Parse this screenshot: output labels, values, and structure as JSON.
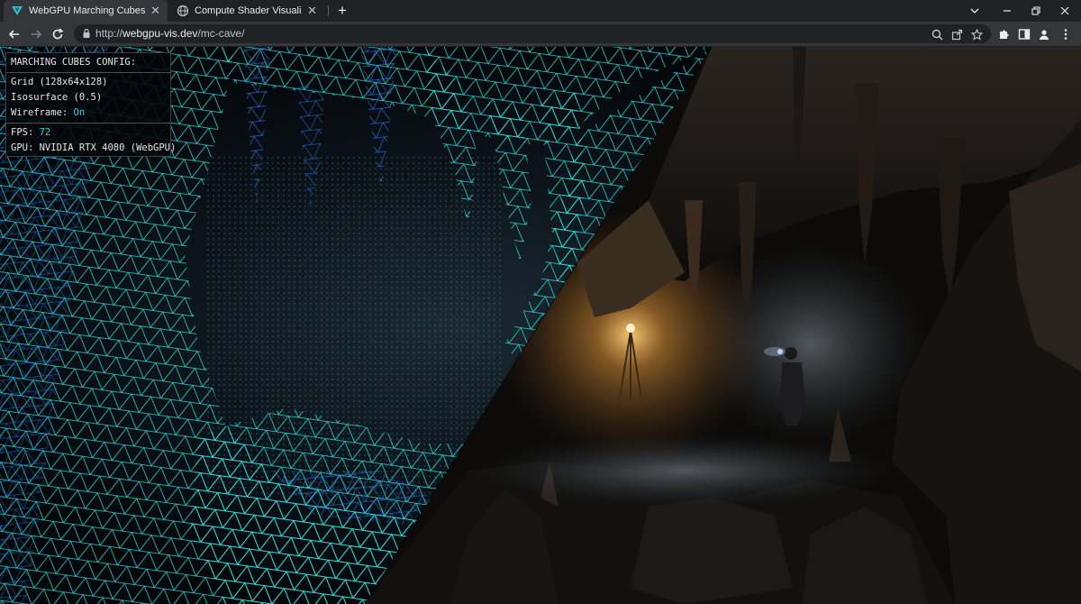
{
  "browser": {
    "tabs": [
      {
        "title": "WebGPU Marching Cubes Cave |",
        "active": true,
        "favicon": "triangle-logo-icon"
      },
      {
        "title": "Compute Shader Visualization",
        "active": false,
        "favicon": "globe-icon"
      }
    ],
    "url_scheme": "http://",
    "url_host": "webgpu-vis.dev",
    "url_path": "/mc-cave/"
  },
  "hud": {
    "heading": "MARCHING CUBES CONFIG:",
    "grid": "Grid (128x64x128)",
    "isosurface": "Isosurface (0.5)",
    "wireframe_label": "Wireframe: ",
    "wireframe_value": "On",
    "fps_label": "FPS: ",
    "fps_value": "72",
    "gpu": "GPU: NVIDIA RTX 4080 (WebGPU)"
  },
  "colors": {
    "wireframe_cyan": "#35e6e0",
    "wireframe_blue": "#1f5fd6",
    "hud_value": "#36d0dc",
    "lamp": "#ffb347"
  }
}
